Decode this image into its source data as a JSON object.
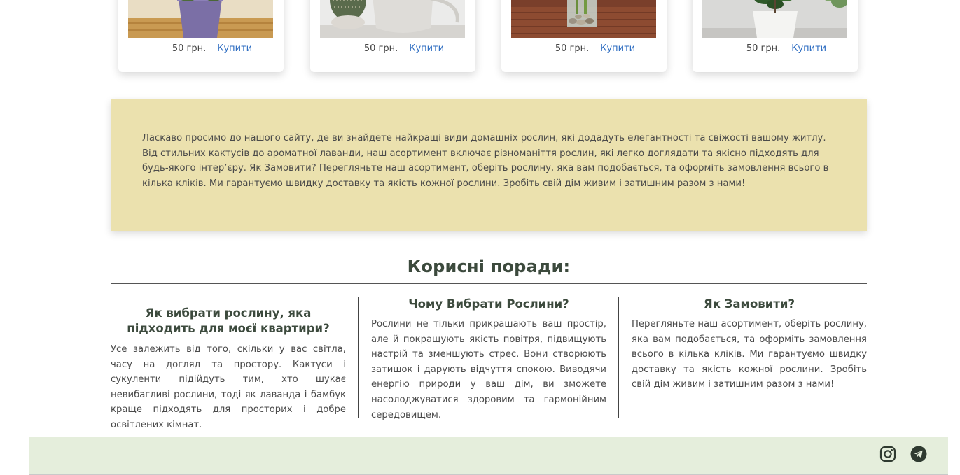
{
  "products": [
    {
      "price": "50 грн.",
      "buy_label": "Купити"
    },
    {
      "price": "50 грн.",
      "buy_label": "Купити"
    },
    {
      "price": "50 грн.",
      "buy_label": "Купити"
    },
    {
      "price": "50 грн.",
      "buy_label": "Купити"
    }
  ],
  "intro": {
    "text": "Ласкаво просимо до нашого сайту, де ви знайдете найкращі види домашніх рослин, які додадуть елегантності та свіжості вашому житлу. Від стильних кактусів до ароматної лаванди, наш асортимент включає різноманіття рослин, які легко доглядати та якісно підходять для будь-якого інтер’єру. Як Замовити? Перегляньте наш асортимент, оберіть рослину, яка вам подобається, та оформіть замовлення всього в кілька кліків. Ми гарантуємо швидку доставку та якість кожної рослини. Зробіть свій дім живим і затишним разом з нами!"
  },
  "tips": {
    "title": "Корисні поради:",
    "columns": [
      {
        "heading": "Як вибрати рослину, яка підходить для моєї квартири?",
        "text": "Усе залежить від того, скільки у вас світла, часу на догляд та простору. Кактуси і сукуленти підійдуть тим, хто шукає невибагливі рослини, тоді як лаванда і бамбук краще підходять для просторих і добре освітлених кімнат."
      },
      {
        "heading": "Чому Вибрати Рослини?",
        "text": "Рослини не тільки прикрашають ваш простір, але й покращують якість повітря, підвищують настрій та зменшують стрес. Вони створюють затишок і дарують відчуття спокою. Виводячи енергію природи у ваш дім, ви зможете насолоджуватися здоровим та гармонійним середовищем."
      },
      {
        "heading": "Як Замовити?",
        "text": "Перегляньте наш асортимент, оберіть рослину, яка вам подобається, та оформіть замовлення всього в кілька кліків. Ми гарантуємо швидку доставку та якість кожної рослини. Зробіть свій дім живим і затишним разом з нами!"
      }
    ]
  },
  "footer": {
    "icons": [
      "instagram-icon",
      "telegram-icon"
    ]
  },
  "colors": {
    "intro_bg": "#ebe1ae",
    "footer_bg": "#e5eedc",
    "link": "#2f6ec2",
    "heading": "#3c4a3d"
  }
}
